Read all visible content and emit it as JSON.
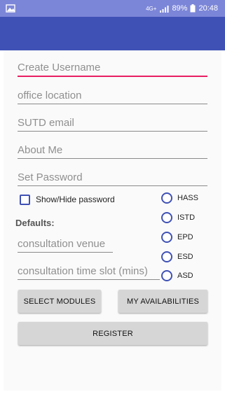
{
  "status_bar": {
    "network": "4G+",
    "battery": "89%",
    "time": "20:48"
  },
  "form": {
    "username_placeholder": "Create Username",
    "office_location_placeholder": "office location",
    "email_placeholder": "SUTD email",
    "about_me_placeholder": "About Me",
    "password_placeholder": "Set Password",
    "show_hide_password_label": "Show/Hide password",
    "defaults_label": "Defaults:",
    "consultation_venue_placeholder": "consultation venue",
    "consultation_slot_placeholder": "consultation time slot (mins)"
  },
  "pillars": [
    "HASS",
    "ISTD",
    "EPD",
    "ESD",
    "ASD"
  ],
  "buttons": {
    "select_modules": "SELECT MODULES",
    "my_availabilities": "MY AVAILABILITIES",
    "register": "REGISTER"
  },
  "colors": {
    "status_bar": "#7c86d8",
    "app_bar": "#3f51b5",
    "focused_underline": "#e91e63",
    "control_accent": "#3f51b5"
  }
}
